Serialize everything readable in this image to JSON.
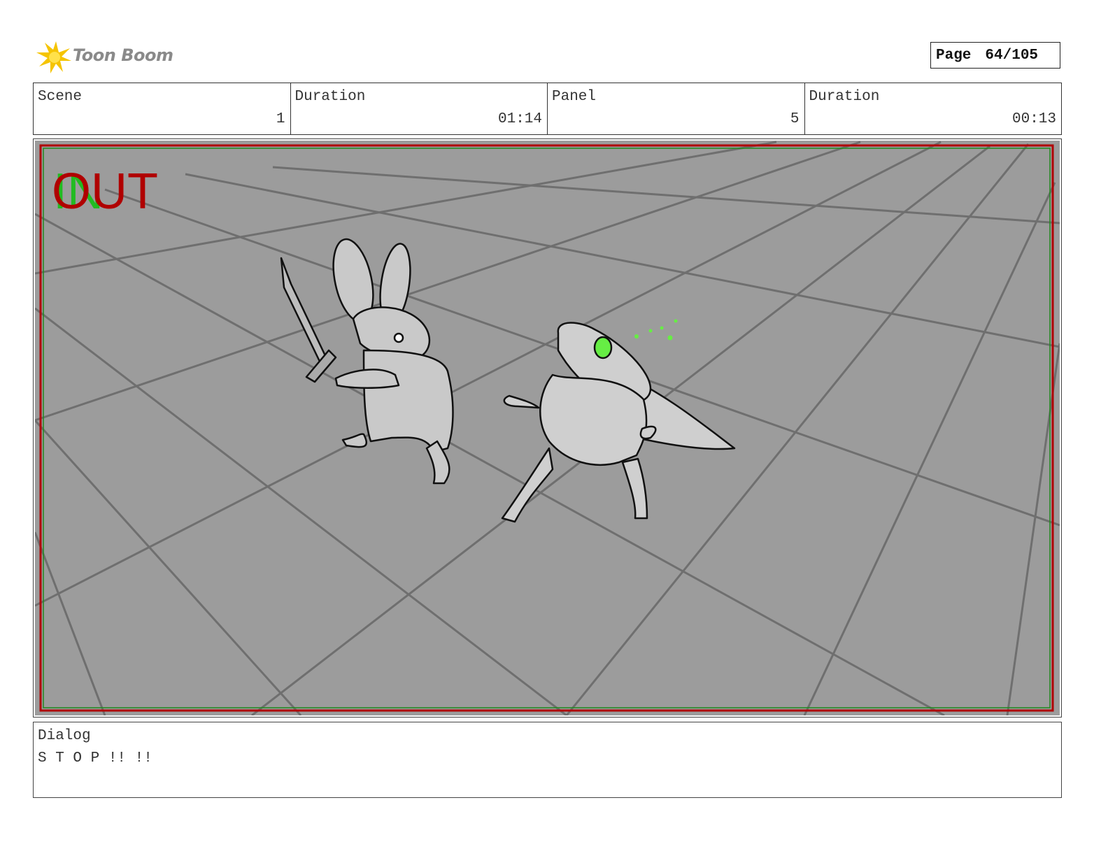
{
  "brand": {
    "name": "Toon Boom",
    "accent": "#f5c400",
    "text_color": "#8a8a8a"
  },
  "page": {
    "label": "Page",
    "value": "64/105"
  },
  "info": [
    {
      "header": "Scene",
      "value": "1"
    },
    {
      "header": "Duration",
      "value": "01:14"
    },
    {
      "header": "Panel",
      "value": "5"
    },
    {
      "header": "Duration",
      "value": "00:13"
    }
  ],
  "panel": {
    "overlay_out": "OUT",
    "overlay_in": "IN",
    "out_color": "#b00000",
    "in_color": "#22bb22",
    "floor_color": "#9c9c9c",
    "eye_color": "#66ee44"
  },
  "dialog": {
    "header": "Dialog",
    "text": "S T O P !! !!"
  }
}
